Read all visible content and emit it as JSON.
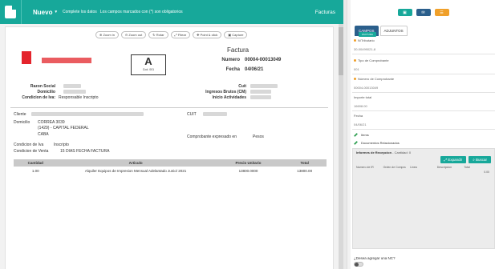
{
  "header": {
    "title": "Nuevo",
    "subtitle": "Complete los datos",
    "required_note": "Los campos marcados con (*) son obligatorios",
    "context": "Facturas",
    "accent": "#17a89a"
  },
  "toolbar": {
    "zoom_in": "Zoom in",
    "zoom_out": "Zoom out",
    "rotate": "Rotar",
    "fit": "Fitear",
    "point_click": "Point & click",
    "capture": "Capture"
  },
  "invoice": {
    "letter": "A",
    "cod": "Cod.    001",
    "doc_title": "Factura",
    "numero_label": "Numero",
    "numero_value": "00004-00013049",
    "fecha_label": "Fecha",
    "fecha_value": "04/06/21",
    "razon_label": "Razon Social",
    "domicilio_label": "Domicilio",
    "condicion_label": "Condicion de Iva:",
    "condicion_value": "Responsable Inscripto",
    "cuit_label": "Cuit",
    "ingresos_label": "Ingresos Brutos (CM)",
    "inicio_label": "Inicio Actividades",
    "cliente_label": "Cliente",
    "cuit2_label": "CUIT",
    "domicilio2_label": "Domicilio",
    "domicilio2_value": "CORREA 3039",
    "address_line2": "(1429) - CAPITAL FEDERAL",
    "address_line3": "CABA",
    "comprobante_label": "Comprobante expresado en",
    "comprobante_value": "Pesos",
    "cond_iva_label": "Condicion de Iva",
    "cond_iva_value": "Inscripto",
    "cond_venta_label": "Condicion de Venta",
    "cond_venta_value": "15 DIAS FECHA FACTURA",
    "table_headers": [
      "Cantidad",
      "Articulo",
      "Precio Unitario",
      "Total"
    ],
    "rows": [
      [
        "1.00",
        "Alquiler Equipos de Impresion Mensual Adelantado Junio/ 2021",
        "13800.0000",
        "13800.00"
      ]
    ]
  },
  "right_panel": {
    "tabs": [
      "CAMPOS",
      "ADJUNTOS"
    ],
    "badge": "FACTURA",
    "fields": [
      {
        "label": "N/Tributario",
        "value": "30-00499021-8"
      },
      {
        "label": "Tipo de Comprobante",
        "value": "001"
      },
      {
        "label": "Número de Comprobante",
        "value": "00004-00013049"
      },
      {
        "label": "Importe total",
        "value": "16698.00"
      },
      {
        "label": "Fecha",
        "value": "04/06/21"
      }
    ],
    "items_label": "Items",
    "docs_label": "Documentos Relacionados",
    "reception_title": "Informes de Recepcion",
    "reception_count": "- Cantidad: 0",
    "expand_button": "Expandir",
    "search_button": "Buscar",
    "reception_columns": [
      "Numero de IR",
      "Orden de Compra",
      "Linea",
      "Descripcion",
      "Total"
    ],
    "reception_total": "0.00",
    "nc_question": "¿Desea agregar una NC?",
    "button_colors": [
      "#17a89a",
      "#2b5f8c",
      "#f0a02a"
    ]
  }
}
